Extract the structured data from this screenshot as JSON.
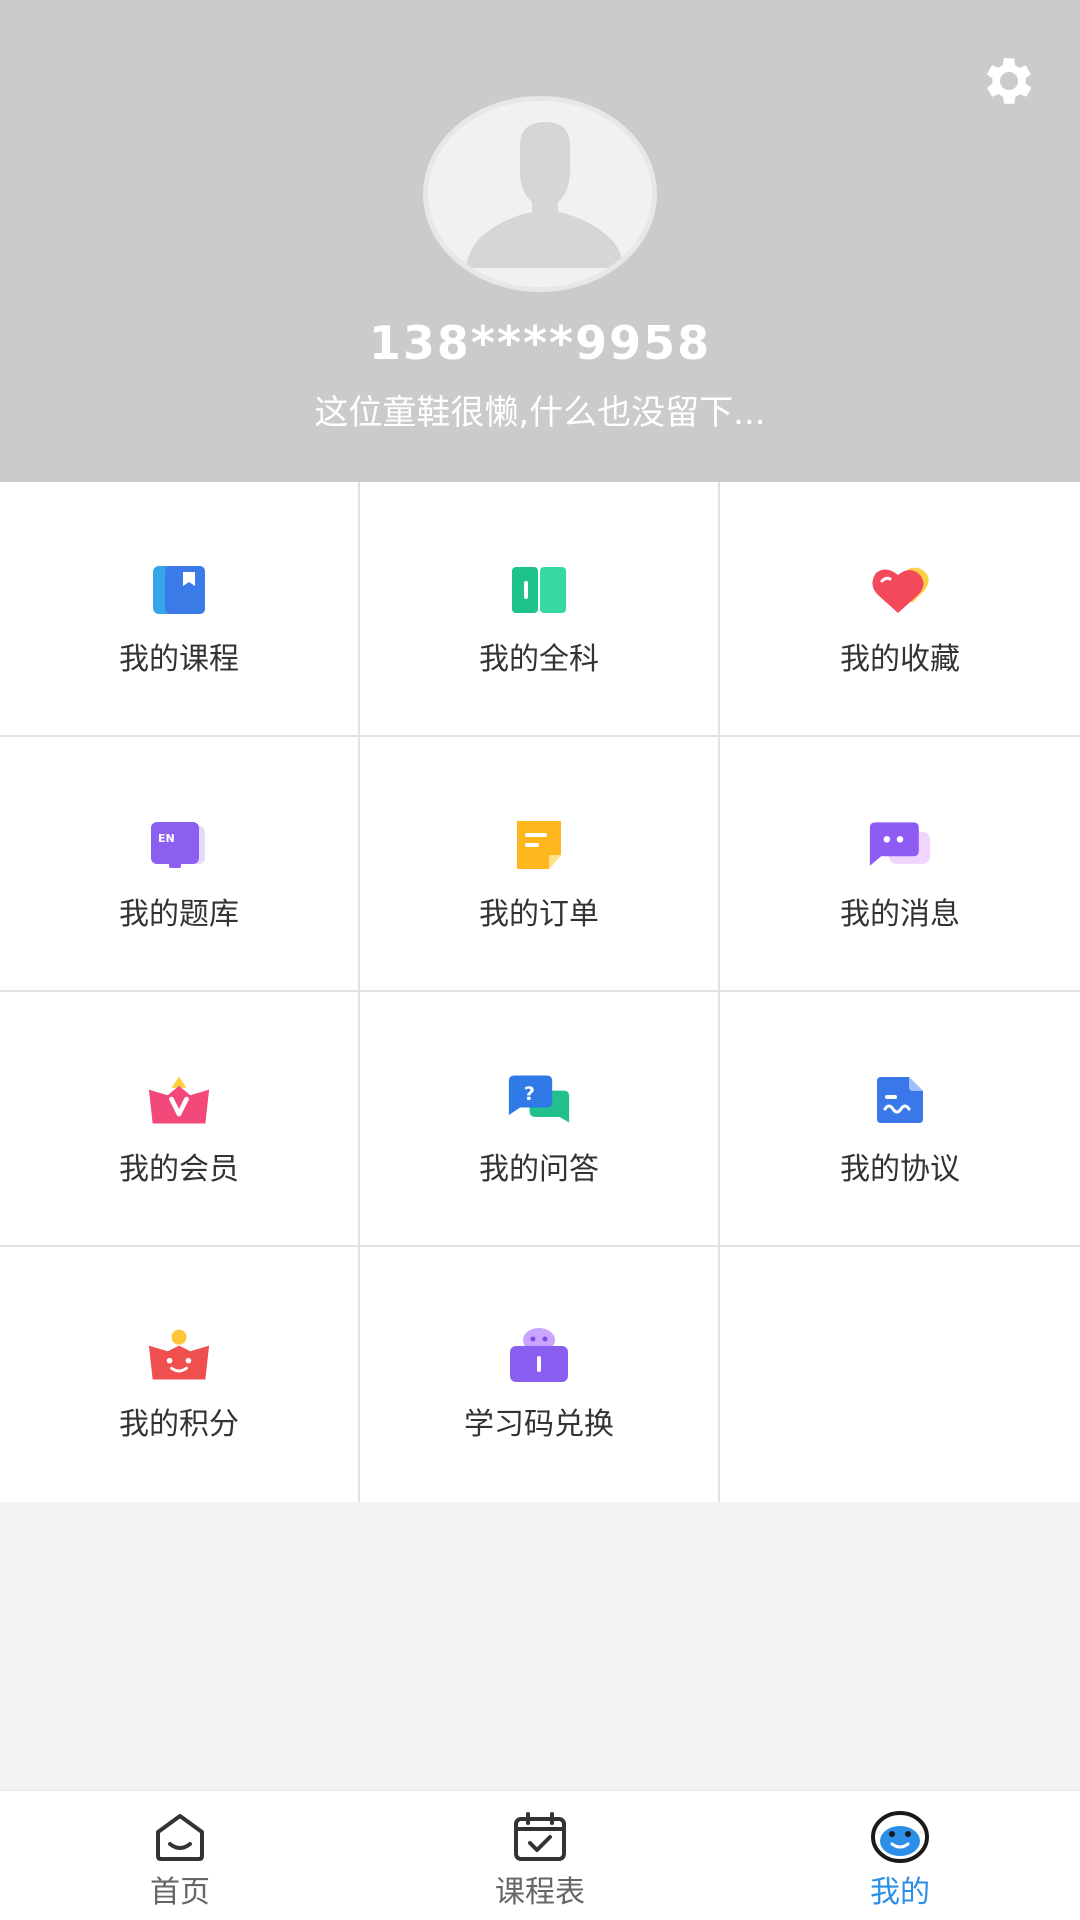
{
  "header": {
    "phone": "138****9958",
    "motto": "这位童鞋很懒,什么也没留下...",
    "settings_icon": "gear-icon",
    "background": "#cbcbcb"
  },
  "grid": {
    "items": [
      {
        "label": "我的课程",
        "icon": "course-book-icon"
      },
      {
        "label": "我的全科",
        "icon": "all-subjects-book-icon"
      },
      {
        "label": "我的收藏",
        "icon": "favorite-heart-icon"
      },
      {
        "label": "我的题库",
        "icon": "question-bank-icon"
      },
      {
        "label": "我的订单",
        "icon": "order-note-icon"
      },
      {
        "label": "我的消息",
        "icon": "message-bubble-icon"
      },
      {
        "label": "我的会员",
        "icon": "vip-crown-icon"
      },
      {
        "label": "我的问答",
        "icon": "qa-bubble-icon"
      },
      {
        "label": "我的协议",
        "icon": "agreement-doc-icon"
      },
      {
        "label": "我的积分",
        "icon": "points-icon"
      },
      {
        "label": "学习码兑换",
        "icon": "study-code-icon"
      }
    ]
  },
  "tabbar": {
    "tabs": [
      {
        "label": "首页",
        "icon": "home-icon",
        "active": false
      },
      {
        "label": "课程表",
        "icon": "calendar-icon",
        "active": false
      },
      {
        "label": "我的",
        "icon": "profile-face-icon",
        "active": true
      }
    ],
    "active_color": "#2b8fe8"
  }
}
